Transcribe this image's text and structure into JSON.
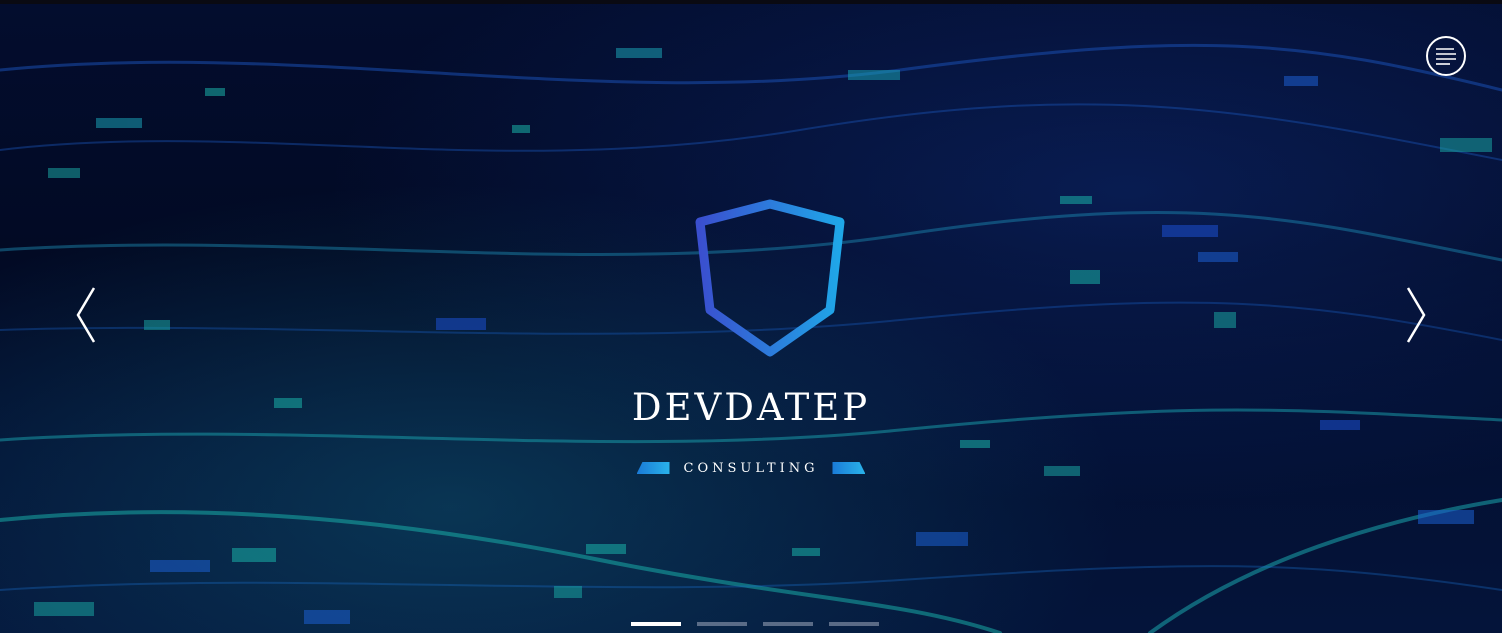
{
  "brand": {
    "name": "DEVDATEP",
    "tagline": "CONSULTING"
  },
  "icons": {
    "menu": "hamburger-menu-icon",
    "prev": "chevron-left-icon",
    "next": "chevron-right-icon",
    "logo": "shield-code-logo"
  },
  "slider": {
    "total_slides": 4,
    "active_index": 0
  },
  "colors": {
    "background": "#020b26",
    "accent_start": "#3a4fcf",
    "accent_end": "#1fa7e8",
    "text": "#ffffff"
  }
}
